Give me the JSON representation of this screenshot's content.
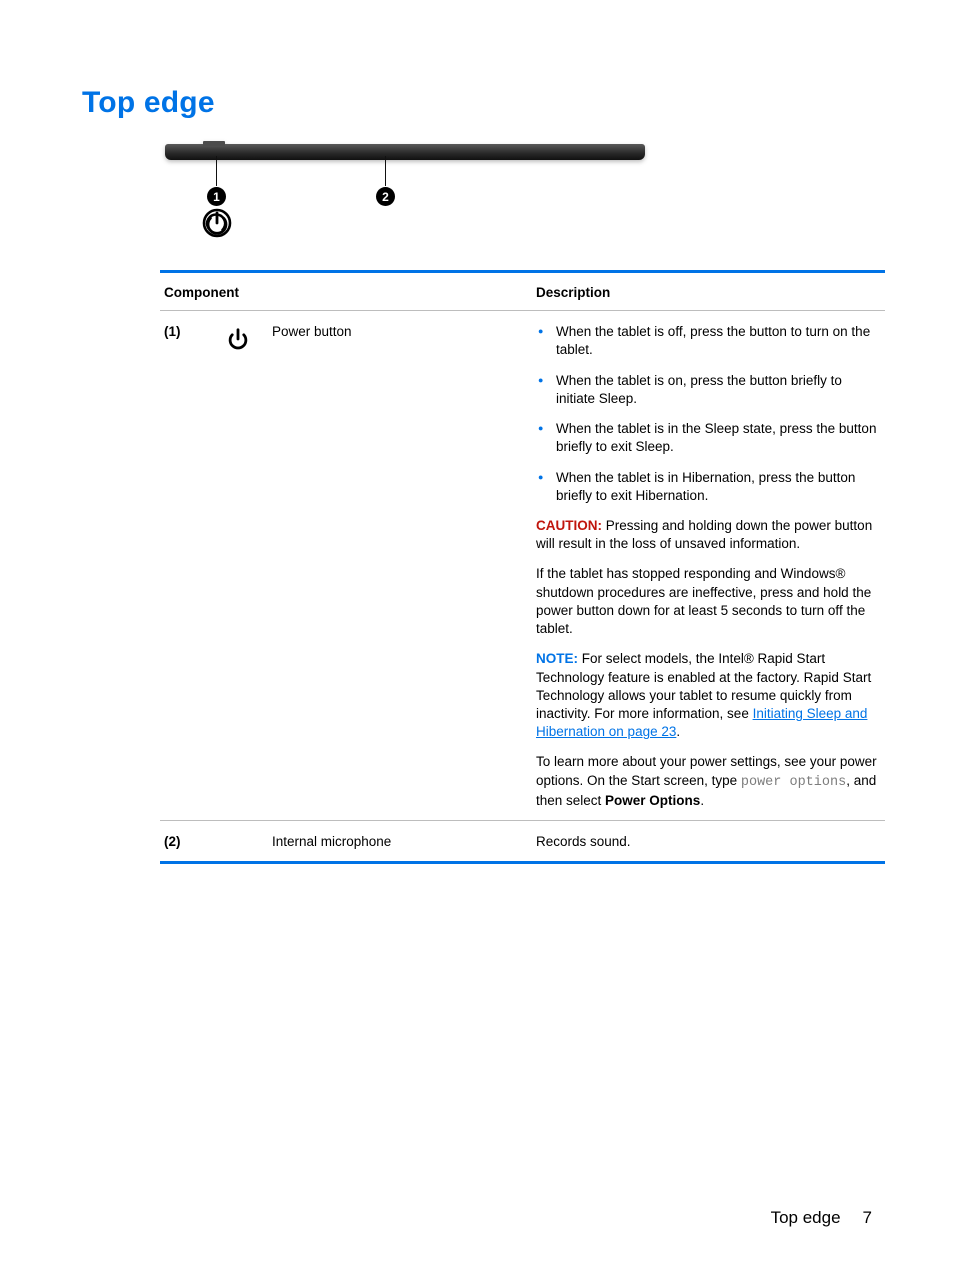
{
  "title": "Top edge",
  "figure": {
    "callouts": {
      "one": "1",
      "two": "2"
    }
  },
  "table": {
    "headers": {
      "component": "Component",
      "description": "Description"
    },
    "rows": {
      "power": {
        "num": "(1)",
        "name": "Power button",
        "bullets": {
          "b1": "When the tablet is off, press the button to turn on the tablet.",
          "b2": "When the tablet is on, press the button briefly to initiate Sleep.",
          "b3": "When the tablet is in the Sleep state, press the button briefly to exit Sleep.",
          "b4": "When the tablet is in Hibernation, press the button briefly to exit Hibernation."
        },
        "caution_label": "CAUTION:",
        "caution_text": "Pressing and holding down the power button will result in the loss of unsaved information.",
        "para_stop": "If the tablet has stopped responding and Windows® shutdown procedures are ineffective, press and hold the power button down for at least 5 seconds to turn off the tablet.",
        "note_label": "NOTE:",
        "note_text_before_link": "For select models, the Intel® Rapid Start Technology feature is enabled at the factory. Rapid Start Technology allows your tablet to resume quickly from inactivity. For more information, see ",
        "note_link": "Initiating Sleep and Hibernation on page 23",
        "note_after_link": ".",
        "learn_before_code": "To learn more about your power settings, see your power options. On the Start screen, type ",
        "learn_code": "power options",
        "learn_after_code": ", and then select ",
        "learn_bold": "Power Options",
        "learn_end": "."
      },
      "mic": {
        "num": "(2)",
        "name": "Internal microphone",
        "desc": "Records sound."
      }
    }
  },
  "footer": {
    "section": "Top edge",
    "page": "7"
  }
}
